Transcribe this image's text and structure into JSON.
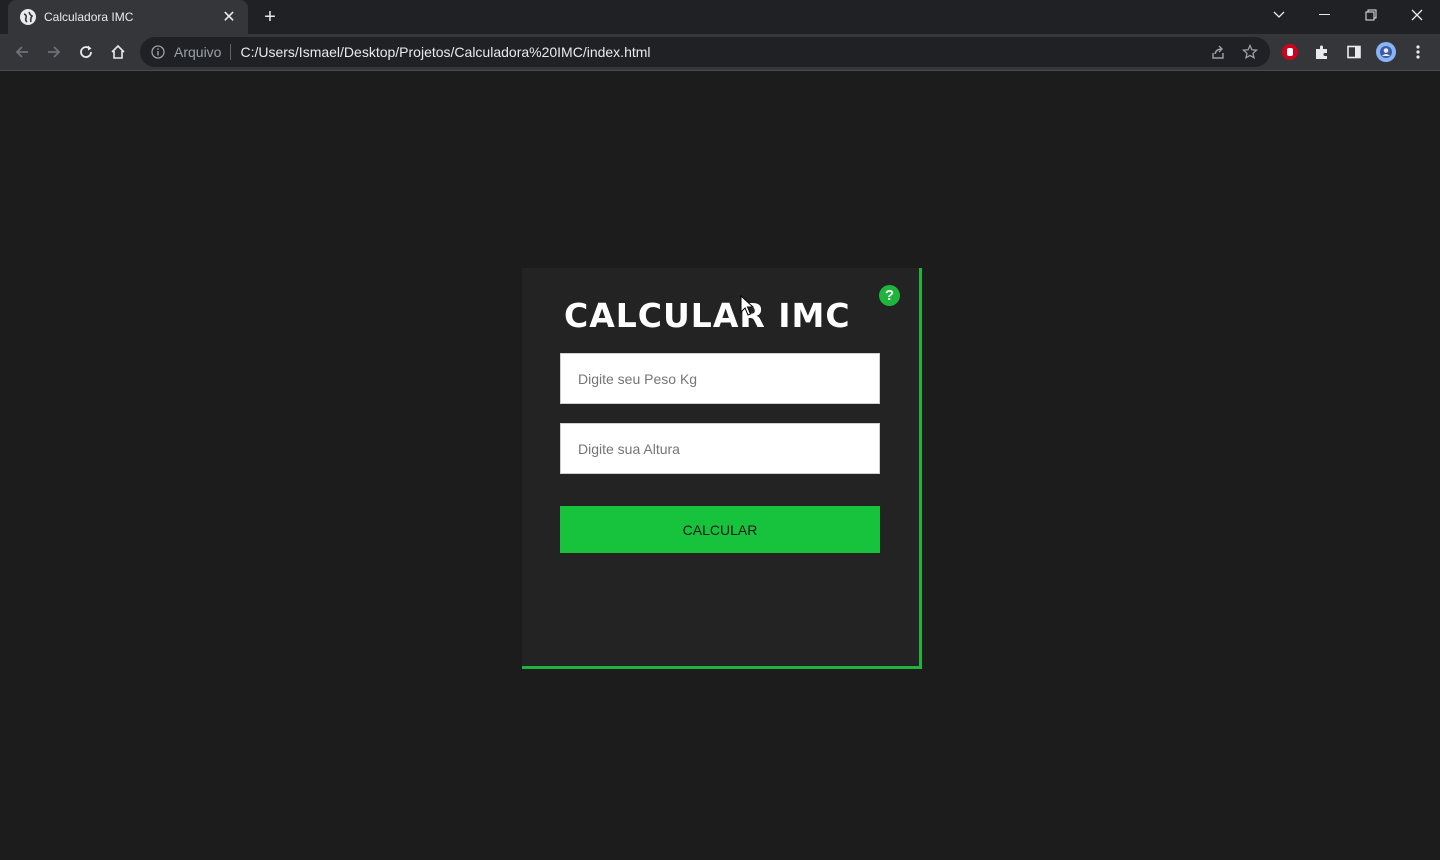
{
  "browser": {
    "tab_title": "Calculadora IMC",
    "address_label": "Arquivo",
    "address_url": "C:/Users/Ismael/Desktop/Projetos/Calculadora%20IMC/index.html"
  },
  "page": {
    "title": "CALCULAR IMC",
    "help_glyph": "?",
    "peso_placeholder": "Digite seu Peso Kg",
    "altura_placeholder": "Digite sua Altura",
    "peso_value": "",
    "altura_value": "",
    "calc_button_label": "CALCULAR"
  },
  "colors": {
    "accent": "#1fb53c",
    "button": "#17c33c",
    "background": "#1c1c1c",
    "card": "#232323"
  }
}
